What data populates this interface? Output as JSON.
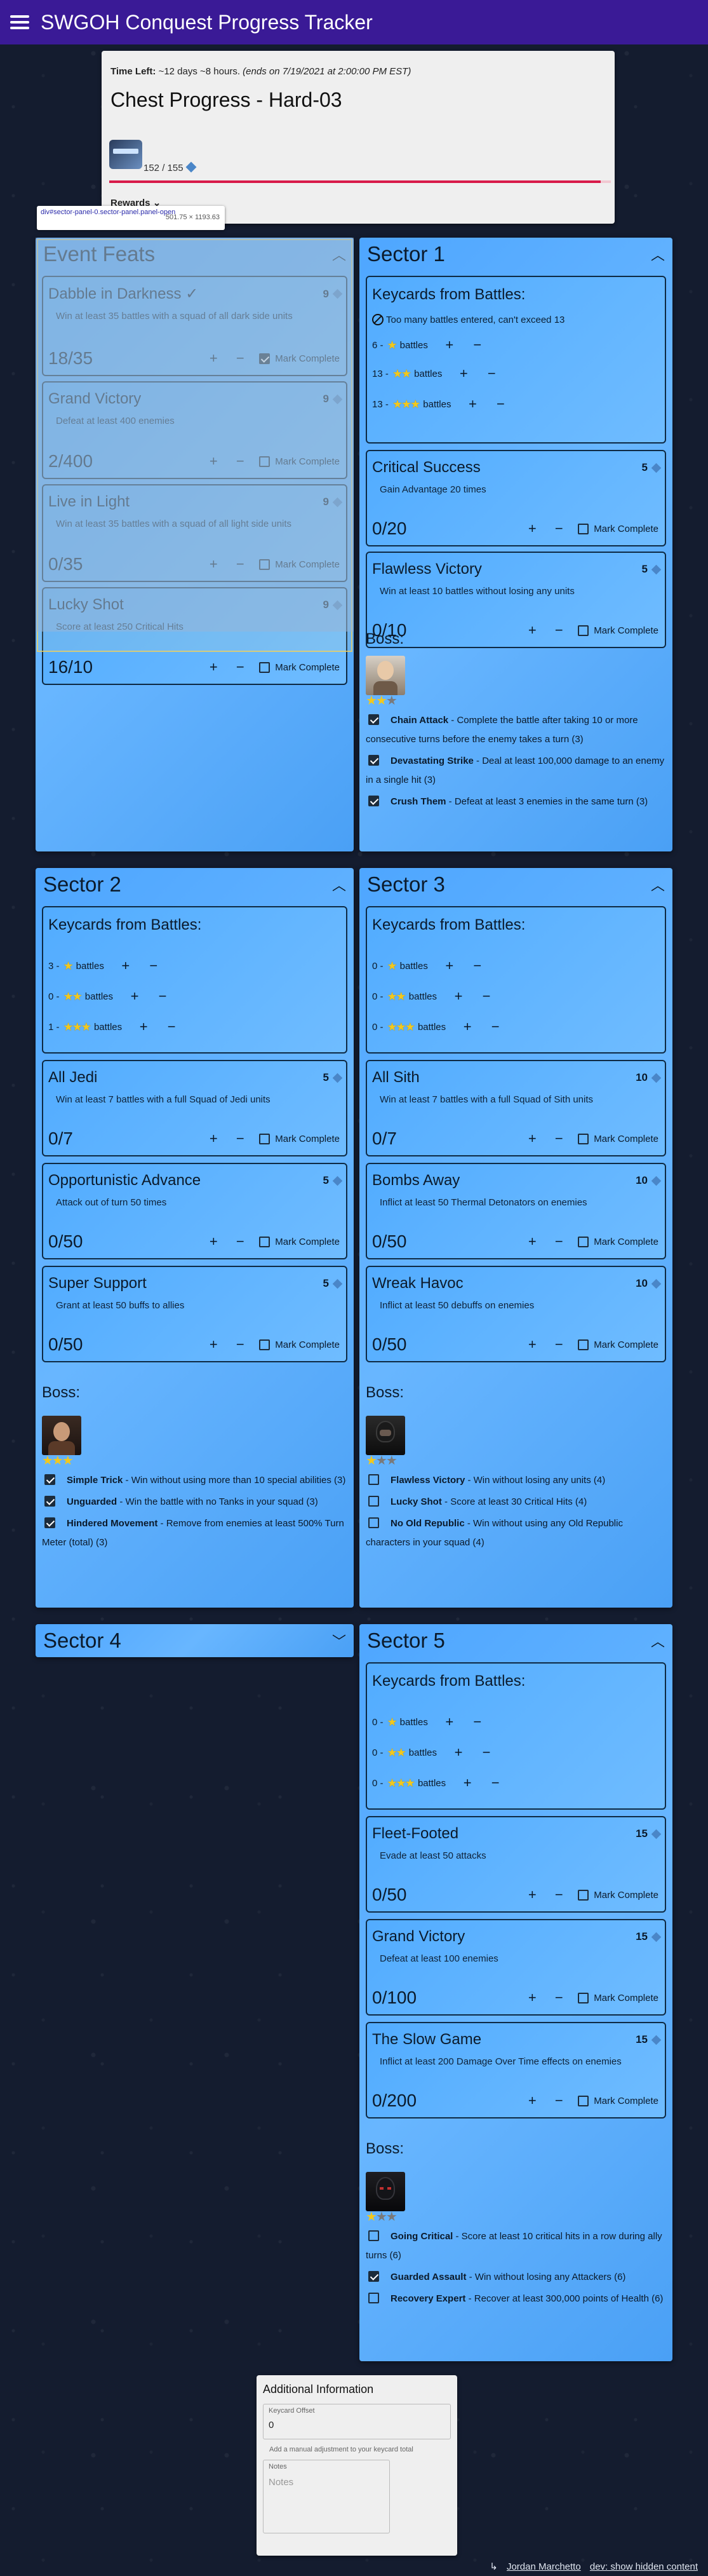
{
  "app": {
    "title": "SWGOH Conquest Progress Tracker"
  },
  "chest": {
    "time_label": "Time Left:",
    "time_value": " ~12 days ~8 hours.",
    "ends": "(ends on 7/19/2021 at 2:00:00 PM EST)",
    "title": "Chest Progress - Hard-03",
    "count": "152 / 155",
    "progress": 0.98,
    "rewards": "Rewards"
  },
  "inspector": {
    "selector": "div#sector-panel-0.sector-panel.panel-open",
    "size": "501.75 × 1193.63"
  },
  "event_feats": {
    "title": "Event Feats",
    "cards": [
      {
        "title": "Dabble in Darkness",
        "pts": "9",
        "desc": "Win at least 35 battles with a squad of all dark side units",
        "progress": "18/35",
        "mark": "Mark Complete",
        "checked": true
      },
      {
        "title": "Grand Victory",
        "pts": "9",
        "desc": "Defeat at least 400 enemies",
        "progress": "2/400",
        "mark": "Mark Complete",
        "checked": false
      },
      {
        "title": "Live in Light",
        "pts": "9",
        "desc": "Win at least 35 battles with a squad of all light side units",
        "progress": "0/35",
        "mark": "Mark Complete",
        "checked": false
      },
      {
        "title": "Lucky Shot",
        "pts": "9",
        "desc": "Score at least 250 Critical Hits",
        "progress": "16/10",
        "mark": "Mark Complete",
        "checked": false
      }
    ]
  },
  "sector1": {
    "title": "Sector 1",
    "keycards": "Keycards from Battles:",
    "warning": "Too many battles entered, can't exceed 13",
    "rows": [
      {
        "count": "6",
        "label": "battles"
      },
      {
        "count": "13",
        "label": "battles"
      },
      {
        "count": "13",
        "label": "battles"
      }
    ],
    "cards": [
      {
        "title": "Critical Success",
        "pts": "5",
        "desc": "Gain Advantage 20 times",
        "progress": "0/20",
        "mark": "Mark Complete"
      },
      {
        "title": "Flawless Victory",
        "pts": "5",
        "desc": "Win at least 10 battles without losing any units",
        "progress": "0/10",
        "mark": "Mark Complete"
      }
    ],
    "boss": {
      "title": "Boss:",
      "items": [
        {
          "name": "Chain Attack",
          "desc": " - Complete the battle after taking 10 or more consecutive turns before the enemy takes a turn (3)",
          "checked": true
        },
        {
          "name": "Devastating Strike",
          "desc": " - Deal at least 100,000 damage to an enemy in a single hit (3)",
          "checked": true
        },
        {
          "name": "Crush Them",
          "desc": " - Defeat at least 3 enemies in the same turn (3)",
          "checked": true
        }
      ]
    }
  },
  "sector2": {
    "title": "Sector 2",
    "keycards": "Keycards from Battles:",
    "rows": [
      {
        "count": "3",
        "label": "battles"
      },
      {
        "count": "0",
        "label": "battles"
      },
      {
        "count": "1",
        "label": "battles"
      }
    ],
    "cards": [
      {
        "title": "All Jedi",
        "pts": "5",
        "desc": "Win at least 7 battles with a full Squad of Jedi units",
        "progress": "0/7",
        "mark": "Mark Complete"
      },
      {
        "title": "Opportunistic Advance",
        "pts": "5",
        "desc": "Attack out of turn 50 times",
        "progress": "0/50",
        "mark": "Mark Complete"
      },
      {
        "title": "Super Support",
        "pts": "5",
        "desc": "Grant at least 50 buffs to allies",
        "progress": "0/50",
        "mark": "Mark Complete"
      }
    ],
    "boss": {
      "title": "Boss:",
      "items": [
        {
          "name": "Simple Trick",
          "desc": " - Win without using more than 10 special abilities (3)",
          "checked": true
        },
        {
          "name": "Unguarded",
          "desc": " - Win the battle with no Tanks in your squad (3)",
          "checked": true
        },
        {
          "name": "Hindered Movement",
          "desc": " - Remove from enemies at least 500% Turn Meter (total) (3)",
          "checked": true
        }
      ]
    }
  },
  "sector3": {
    "title": "Sector 3",
    "keycards": "Keycards from Battles:",
    "rows": [
      {
        "count": "0",
        "label": "battles"
      },
      {
        "count": "0",
        "label": "battles"
      },
      {
        "count": "0",
        "label": "battles"
      }
    ],
    "cards": [
      {
        "title": "All Sith",
        "pts": "10",
        "desc": "Win at least 7 battles with a full Squad of Sith units",
        "progress": "0/7",
        "mark": "Mark Complete"
      },
      {
        "title": "Bombs Away",
        "pts": "10",
        "desc": "Inflict at least 50 Thermal Detonators on enemies",
        "progress": "0/50",
        "mark": "Mark Complete"
      },
      {
        "title": "Wreak Havoc",
        "pts": "10",
        "desc": "Inflict at least 50 debuffs on enemies",
        "progress": "0/50",
        "mark": "Mark Complete"
      }
    ],
    "boss": {
      "title": "Boss:",
      "items": [
        {
          "name": "Flawless Victory",
          "desc": " - Win without losing any units (4)",
          "checked": false
        },
        {
          "name": "Lucky Shot",
          "desc": " - Score at least 30 Critical Hits (4)",
          "checked": false
        },
        {
          "name": "No Old Republic",
          "desc": " - Win without using any Old Republic characters in your squad (4)",
          "checked": false
        }
      ]
    }
  },
  "sector4": {
    "title": "Sector 4"
  },
  "sector5": {
    "title": "Sector 5",
    "keycards": "Keycards from Battles:",
    "rows": [
      {
        "count": "0",
        "label": "battles"
      },
      {
        "count": "0",
        "label": "battles"
      },
      {
        "count": "0",
        "label": "battles"
      }
    ],
    "cards": [
      {
        "title": "Fleet-Footed",
        "pts": "15",
        "desc": "Evade at least 50 attacks",
        "progress": "0/50",
        "mark": "Mark Complete"
      },
      {
        "title": "Grand Victory",
        "pts": "15",
        "desc": "Defeat at least 100 enemies",
        "progress": "0/100",
        "mark": "Mark Complete"
      },
      {
        "title": "The Slow Game",
        "pts": "15",
        "desc": "Inflict at least 200 Damage Over Time effects on enemies",
        "progress": "0/200",
        "mark": "Mark Complete"
      }
    ],
    "boss": {
      "title": "Boss:",
      "items": [
        {
          "name": "Going Critical",
          "desc": " - Score at least 10 critical hits in a row during ally turns (6)",
          "checked": false
        },
        {
          "name": "Guarded Assault",
          "desc": " - Win without losing any Attackers (6)",
          "checked": true
        },
        {
          "name": "Recovery Expert",
          "desc": " - Recover at least 300,000 points of Health (6)",
          "checked": false
        }
      ]
    }
  },
  "additional": {
    "title": "Additional Information",
    "offset_label": "Keycard Offset",
    "offset_value": "0",
    "offset_hint": "Add a manual adjustment to your keycard total",
    "notes_label": "Notes",
    "notes_placeholder": "Notes"
  },
  "footer": {
    "author": "Jordan Marchetto",
    "dev": "dev: show hidden content"
  },
  "colors": {
    "topbar": "#3a1a96",
    "panel": "#4ea6ff",
    "progress": "#d81b4a",
    "star": "#f2c81e"
  }
}
